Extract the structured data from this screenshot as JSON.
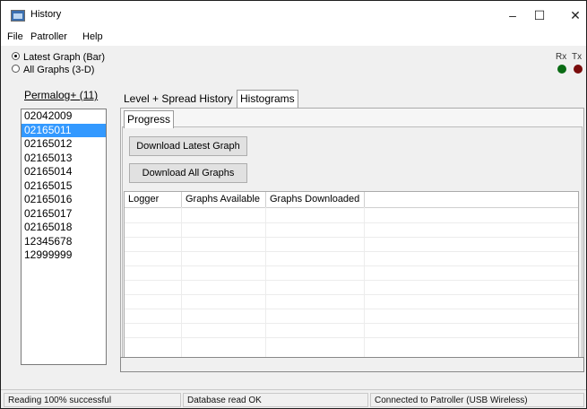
{
  "window": {
    "title": "History",
    "controls": {
      "minimize": "–",
      "maximize": "☐",
      "close": "✕"
    }
  },
  "menu": {
    "items": [
      "File",
      "Patroller",
      "Help"
    ]
  },
  "options": {
    "latest": "Latest Graph (Bar)",
    "all": "All Graphs (3-D)",
    "selected": "latest"
  },
  "indicators": {
    "rx_label": "Rx",
    "tx_label": "Tx",
    "rx_color": "#0a6b14",
    "tx_color": "#7a0c0c"
  },
  "permalog": {
    "link_label": "Permalog+ (11)",
    "items": [
      "02042009",
      "02165011",
      "02165012",
      "02165013",
      "02165014",
      "02165015",
      "02165016",
      "02165017",
      "02165018",
      "12345678",
      "12999999"
    ],
    "selected_index": 1
  },
  "tabs": {
    "level_spread": "Level + Spread History",
    "histograms": "Histograms",
    "progress": "Progress"
  },
  "buttons": {
    "download_latest": "Download Latest Graph",
    "download_all": "Download All Graphs"
  },
  "table": {
    "columns": [
      "Logger",
      "Graphs Available",
      "Graphs Downloaded"
    ],
    "rows": []
  },
  "status": {
    "reading": "Reading 100% successful",
    "database": "Database read OK",
    "connection": "Connected to Patroller (USB Wireless)"
  }
}
